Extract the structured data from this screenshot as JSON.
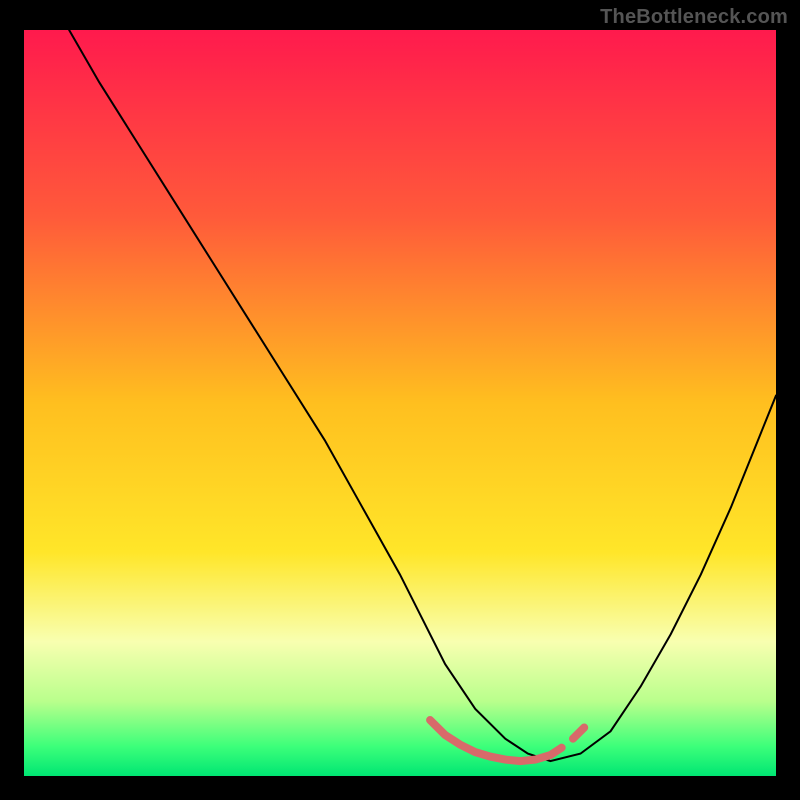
{
  "watermark": "TheBottleneck.com",
  "chart_data": {
    "type": "line",
    "title": "",
    "xlabel": "",
    "ylabel": "",
    "xlim": [
      0,
      100
    ],
    "ylim": [
      0,
      100
    ],
    "grid": false,
    "legend": false,
    "background_gradient_stops": [
      {
        "offset": 0.0,
        "color": "#ff1a4d"
      },
      {
        "offset": 0.25,
        "color": "#ff5a3a"
      },
      {
        "offset": 0.5,
        "color": "#ffbf1f"
      },
      {
        "offset": 0.7,
        "color": "#ffe629"
      },
      {
        "offset": 0.82,
        "color": "#f8ffb0"
      },
      {
        "offset": 0.9,
        "color": "#b9ff8c"
      },
      {
        "offset": 0.96,
        "color": "#3dff7a"
      },
      {
        "offset": 1.0,
        "color": "#00e673"
      }
    ],
    "series": [
      {
        "name": "bottleneck-curve",
        "stroke": "#000000",
        "stroke_width": 2,
        "x": [
          6,
          10,
          15,
          20,
          25,
          30,
          35,
          40,
          45,
          50,
          53,
          56,
          60,
          64,
          67,
          70,
          74,
          78,
          82,
          86,
          90,
          94,
          98,
          100
        ],
        "y": [
          100,
          93,
          85,
          77,
          69,
          61,
          53,
          45,
          36,
          27,
          21,
          15,
          9,
          5,
          3,
          2,
          3,
          6,
          12,
          19,
          27,
          36,
          46,
          51
        ]
      },
      {
        "name": "optimal-band",
        "stroke": "#d86a6a",
        "stroke_width": 8,
        "linecap": "round",
        "x": [
          54,
          56,
          58,
          60,
          62,
          64,
          66,
          68,
          70,
          71.5,
          73,
          74.5
        ],
        "y": [
          7.5,
          5.5,
          4.2,
          3.2,
          2.6,
          2.2,
          2.0,
          2.2,
          2.8,
          3.8,
          5.0,
          6.5
        ]
      }
    ],
    "optimal_band_gap": {
      "x": 72.2,
      "y": 4.3
    }
  }
}
